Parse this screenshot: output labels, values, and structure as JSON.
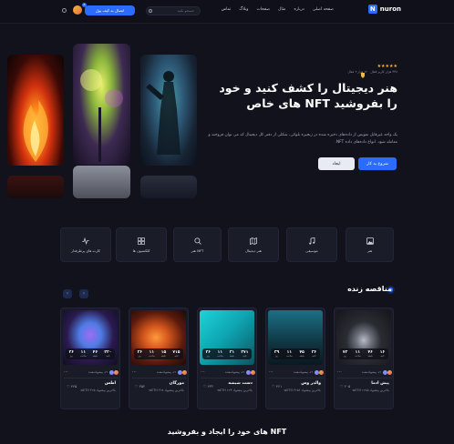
{
  "header": {
    "logo_text": "nuron",
    "logo_badge": "N",
    "nav": [
      "صفحه اصلی",
      "درباره",
      "مثال",
      "صفحات",
      "وبلاگ",
      "تماس"
    ],
    "search_placeholder": "جستجو بکنید",
    "connect_label": "اتصال به کیف پول",
    "notif_count": "6"
  },
  "hero": {
    "stars": "★★★★★",
    "rating_text": "۴۳۸ هزار کاربر فعال",
    "users_badge": "۱۲ هزار+ فعال",
    "title": "هنر دیجیتال را کشف کنید و خود را بفروشید NFT های خاص",
    "description": "یک واحد غیرقابل تعویض از داده‌های ذخیره شده در زنجیره بلوکی، شکلی از دفتر کل دیجیتال که می توان فروخته و معامله شود. انواع داده‌های داده NFT.",
    "primary_btn": "شروع به کار",
    "secondary_btn": "ایجاد"
  },
  "categories": [
    {
      "label": "هنر",
      "icon": "image-icon"
    },
    {
      "label": "موسیقی",
      "icon": "music-icon"
    },
    {
      "label": "هنر دیجیتال",
      "icon": "map-icon"
    },
    {
      "label": "هنر NFT",
      "icon": "search-icon"
    },
    {
      "label": "کلکسیون ها",
      "icon": "grid-icon"
    },
    {
      "label": "کارت های پرطرفدار",
      "icon": "pulse-icon"
    }
  ],
  "live": {
    "title": "مناقصه زنده",
    "prev": "‹",
    "next": "›",
    "timer_labels": [
      "روز",
      "ساعت",
      "دقیقه",
      "ثانیه"
    ],
    "cards": [
      {
        "title": "پیش ادما",
        "bid": "بالاترین پیشنهاد ۲۲۸۵ wETH",
        "likes": "♡ ۲۰۵",
        "owner": "۹+ پیشنهاددهنده",
        "timer": [
          "۷۲",
          "۱۱",
          "۴۶",
          "۱۶"
        ]
      },
      {
        "title": "والدر وس",
        "bid": "بالاترین پیشنهاد ۴۲۵۶ wETH",
        "likes": "♡ ۴۶۱",
        "owner": "۹+ پیشنهاددهنده",
        "timer": [
          "۳۹",
          "۱۱",
          "۴۵",
          "۳۶"
        ]
      },
      {
        "title": "دست شیشه",
        "bid": "بالاترین پیشنهاد ۲۲۴ wETH",
        "likes": "♡ ۴۳۲",
        "owner": "۹+ پیشنهاددهنده",
        "timer": [
          "۲۶",
          "۱۱",
          "۳۱",
          "۳۷۱"
        ]
      },
      {
        "title": "مورگان",
        "bid": "بالاترین پیشنهاد ۳۲۸ wETH",
        "likes": "♡ ۳۵۲",
        "owner": "۹+ پیشنهاددهنده",
        "timer": [
          "۲۶",
          "۱۱",
          "۱۵",
          "۷۱۵"
        ]
      },
      {
        "title": "اطس",
        "bid": "بالاترین پیشنهاد ۴۲۵ wETH",
        "likes": "♡ ۴۴۵",
        "owner": "۹+ پیشنهاددهنده",
        "timer": [
          "۲۶",
          "۱۱",
          "۴۶",
          "۲۲۰"
        ]
      }
    ]
  },
  "bottom_title": "NFT های خود را ایجاد و بفروشید",
  "colors": {
    "accent": "#2b6cff",
    "bg": "#11121c",
    "card": "#191b27"
  }
}
